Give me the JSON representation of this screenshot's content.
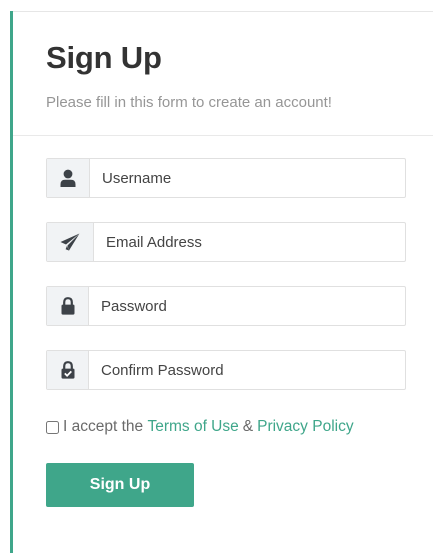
{
  "form": {
    "title": "Sign Up",
    "subtitle": "Please fill in this form to create an account!",
    "fields": [
      {
        "placeholder": "Username",
        "icon": "user-icon"
      },
      {
        "placeholder": "Email Address",
        "icon": "paper-plane-icon"
      },
      {
        "placeholder": "Password",
        "icon": "lock-icon"
      },
      {
        "placeholder": "Confirm Password",
        "icon": "lock-check-icon"
      }
    ],
    "terms": {
      "prefix": "I accept the",
      "terms_link": "Terms of Use",
      "ampersand": "&",
      "privacy_link": "Privacy Policy"
    },
    "submit_label": "Sign Up"
  },
  "colors": {
    "accent": "#3fa68a",
    "icon": "#3d4248",
    "addon_bg": "#f1f3f5"
  }
}
